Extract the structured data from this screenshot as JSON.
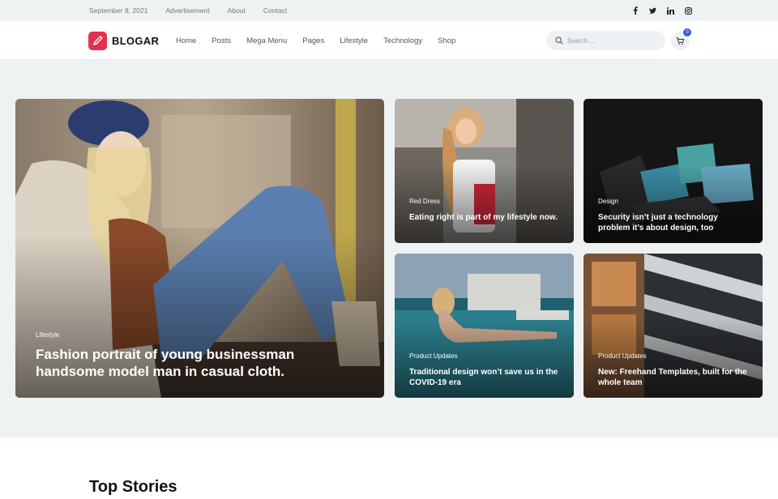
{
  "topbar": {
    "date": "September 8, 2021",
    "links": [
      "Advertisement",
      "About",
      "Contact"
    ],
    "social": [
      "facebook-icon",
      "twitter-icon",
      "linkedin-icon",
      "instagram-icon"
    ]
  },
  "header": {
    "logo_text": "BLOGAR",
    "nav": [
      "Home",
      "Posts",
      "Mega Menu",
      "Pages",
      "Lifestyle",
      "Technology",
      "Shop"
    ],
    "search_placeholder": "Search ...",
    "cart_count": "0"
  },
  "featured": {
    "category": "Lifestyle",
    "title": "Fashion portrait of young businessman handsome model man in casual cloth."
  },
  "cards": [
    {
      "category": "Red Dress",
      "title": "Eating right is part of my lifestyle now."
    },
    {
      "category": "Design",
      "title": "Security isn’t just a technology problem it’s about design, too"
    },
    {
      "category": "Product Updates",
      "title": "Traditional design won’t save us in the COVID-19 era"
    },
    {
      "category": "Product Updates",
      "title": "New: Freehand Templates, built for the whole team"
    }
  ],
  "section": {
    "heading": "Top Stories"
  },
  "colors": {
    "brand": "#e5304a",
    "badge": "#3a5bd9"
  }
}
